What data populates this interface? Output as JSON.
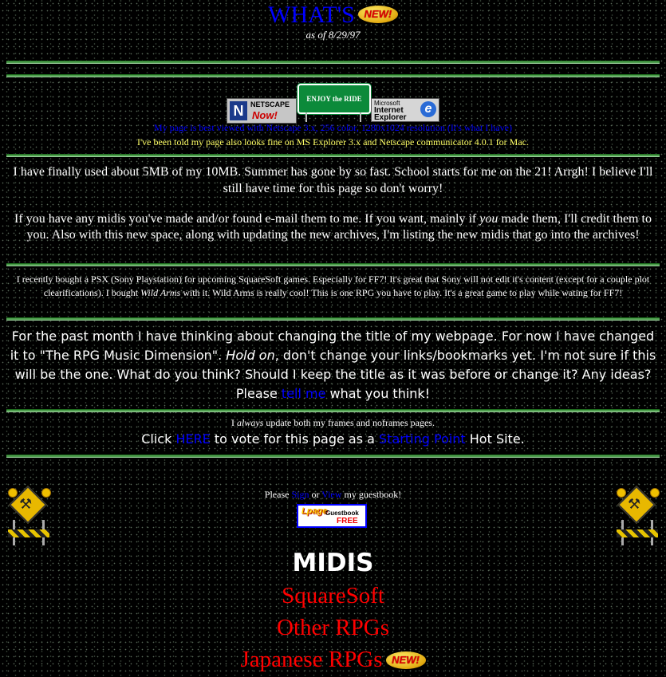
{
  "header": {
    "title": "WHAT'S",
    "new_badge": "NEW!",
    "as_of": "as of 8/29/97"
  },
  "badges": {
    "netscape_line1": "NETSCAPE",
    "netscape_line2": "Now!",
    "enjoy": "ENJOY the RIDE",
    "ie_line1": "Microsoft",
    "ie_line2": "Internet",
    "ie_line3": "Explorer"
  },
  "notices": {
    "best_viewed": "My page is best viewed with Netscape 3.x, 256 color, 1280x1024 resolution (It's what I have)",
    "mac_note": "I've been told my page also looks fine on MS Explorer 3.x and Netscape communicator 4.0.1 for Mac."
  },
  "paragraphs": {
    "p1": "I have finally used about 5MB of my 10MB. Summer has gone by so fast. School starts for me on the 21! Arrgh! I believe I'll still have time for this page so don't worry!",
    "p2_a": "If you have any midis you've made and/or found e-mail them to me. If you want, mainly if ",
    "p2_em": "you",
    "p2_b": " made them, I'll credit them to you. Also with this new space, along with updating the new archives, I'm listing the new midis that go into the archives!",
    "p3_a": "I recently bought a PSX (Sony Playstation) for upcoming SquareSoft games. Especially for FF7! It's great that Sony will not edit it's content (except for a couple plot clearifications). I bought ",
    "p3_em": "Wild Arms",
    "p3_b": " with it. Wild Arms is really cool! This is one RPG you have to play. It's a great game to play while wating for FF7!",
    "p4_a": "For the past month I have thinking about changing the title of my webpage. For now I have changed it to \"The RPG Music Dimension\". ",
    "p4_em": "Hold on",
    "p4_b": ", don't change your links/bookmarks yet. I'm not sure if this will be the one. What do you think? Should I keep the title as it was before or change it? Any ideas? Please ",
    "p4_link": "tell me",
    "p4_c": " what you think!",
    "p5_a": "I ",
    "p5_em": "always",
    "p5_b": " update both my frames and noframes pages.",
    "p6_a": "Click ",
    "p6_link1": "HERE",
    "p6_b": " to vote for this page as a ",
    "p6_link2": "Starting Point",
    "p6_c": " Hot Site."
  },
  "guestbook": {
    "text_a": "Please ",
    "sign": "Sign",
    "text_b": " or ",
    "view": "View",
    "text_c": " my guestbook!",
    "btn_1": "Lpage",
    "btn_2": "Guestbook",
    "btn_3": "FREE"
  },
  "midis": {
    "heading": "MIDIS",
    "links": [
      "SquareSoft",
      "Other RPGs",
      "Japanese RPGs"
    ],
    "new_badge": "NEW!"
  },
  "colors": {
    "title": "#0000ff",
    "link": "#0000ff",
    "midi_link": "#ff0000",
    "rule": "#4e9e4e",
    "mac_note": "#ffff66"
  }
}
